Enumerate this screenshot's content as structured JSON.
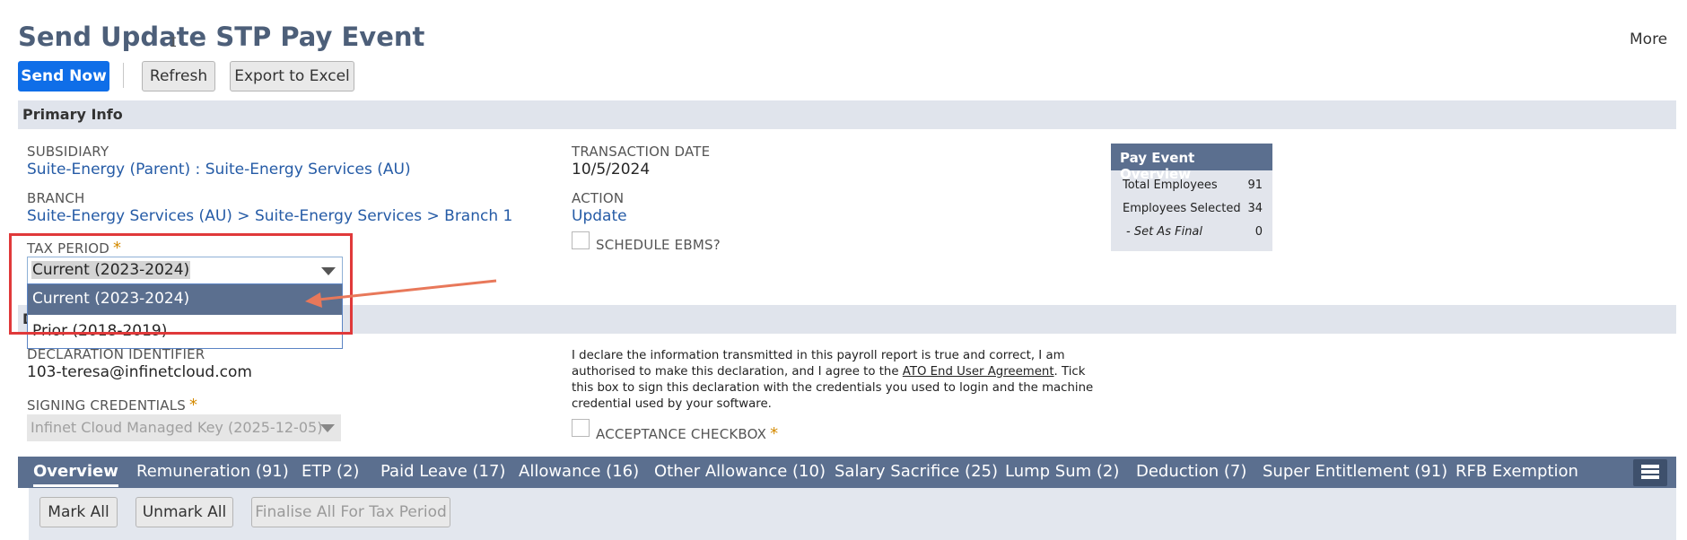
{
  "header": {
    "title": "Send Update STP Pay Event",
    "more_label": "More"
  },
  "toolbar": {
    "send_now": "Send Now",
    "refresh": "Refresh",
    "export": "Export to Excel"
  },
  "primary_info": {
    "section_label": "Primary Info",
    "subsidiary_label": "SUBSIDIARY",
    "subsidiary_value": "Suite-Energy (Parent) : Suite-Energy Services (AU)",
    "branch_label": "BRANCH",
    "branch_value": "Suite-Energy Services (AU) > Suite-Energy Services > Branch 1",
    "tax_period_label": "TAX PERIOD",
    "tax_period_value": "Current (2023-2024)",
    "tax_period_options": [
      "Current (2023-2024)",
      "Prior (2018-2019)"
    ],
    "transaction_date_label": "TRANSACTION DATE",
    "transaction_date_value": "10/5/2024",
    "action_label": "ACTION",
    "action_value": "Update",
    "schedule_ebms_label": "SCHEDULE EBMS?",
    "required_marker": "*"
  },
  "pay_event_overview": {
    "title": "Pay Event Overview",
    "rows": [
      {
        "label": "Total Employees",
        "value": "91"
      },
      {
        "label": "Employees Selected",
        "value": "34"
      },
      {
        "label": "- Set As Final",
        "value": "0"
      }
    ]
  },
  "declaration": {
    "section_label": "D",
    "identifier_label": "DECLARATION IDENTIFIER",
    "identifier_value": "103-teresa@infinetcloud.com",
    "signing_label": "SIGNING CREDENTIALS",
    "signing_value": "Infinet Cloud Managed Key (2025-12-05)",
    "text_before_link": "I declare the information transmitted in this payroll report is true and correct, I am authorised to make this declaration, and I agree to the ",
    "link_text": "ATO End User Agreement",
    "text_after_link": ". Tick this box to sign this declaration with the credentials you used to login and the machine credential used by your software.",
    "acceptance_label": "ACCEPTANCE CHECKBOX"
  },
  "tabs": [
    {
      "label": "Overview"
    },
    {
      "label": "Remuneration (91)"
    },
    {
      "label": "ETP (2)"
    },
    {
      "label": "Paid Leave (17)"
    },
    {
      "label": "Allowance (16)"
    },
    {
      "label": "Other Allowance (10)"
    },
    {
      "label": "Salary Sacrifice (25)"
    },
    {
      "label": "Lump Sum (2)"
    },
    {
      "label": "Deduction (7)"
    },
    {
      "label": "Super Entitlement (91)"
    },
    {
      "label": "RFB Exemption"
    }
  ],
  "subtab_buttons": {
    "mark_all": "Mark All",
    "unmark_all": "Unmark All",
    "finalise": "Finalise All For Tax Period"
  },
  "colors": {
    "primary_button": "#0f6ee8",
    "tab_bar": "#5b6f8f",
    "annotation": "#e0393a",
    "arrow": "#e8785a"
  }
}
